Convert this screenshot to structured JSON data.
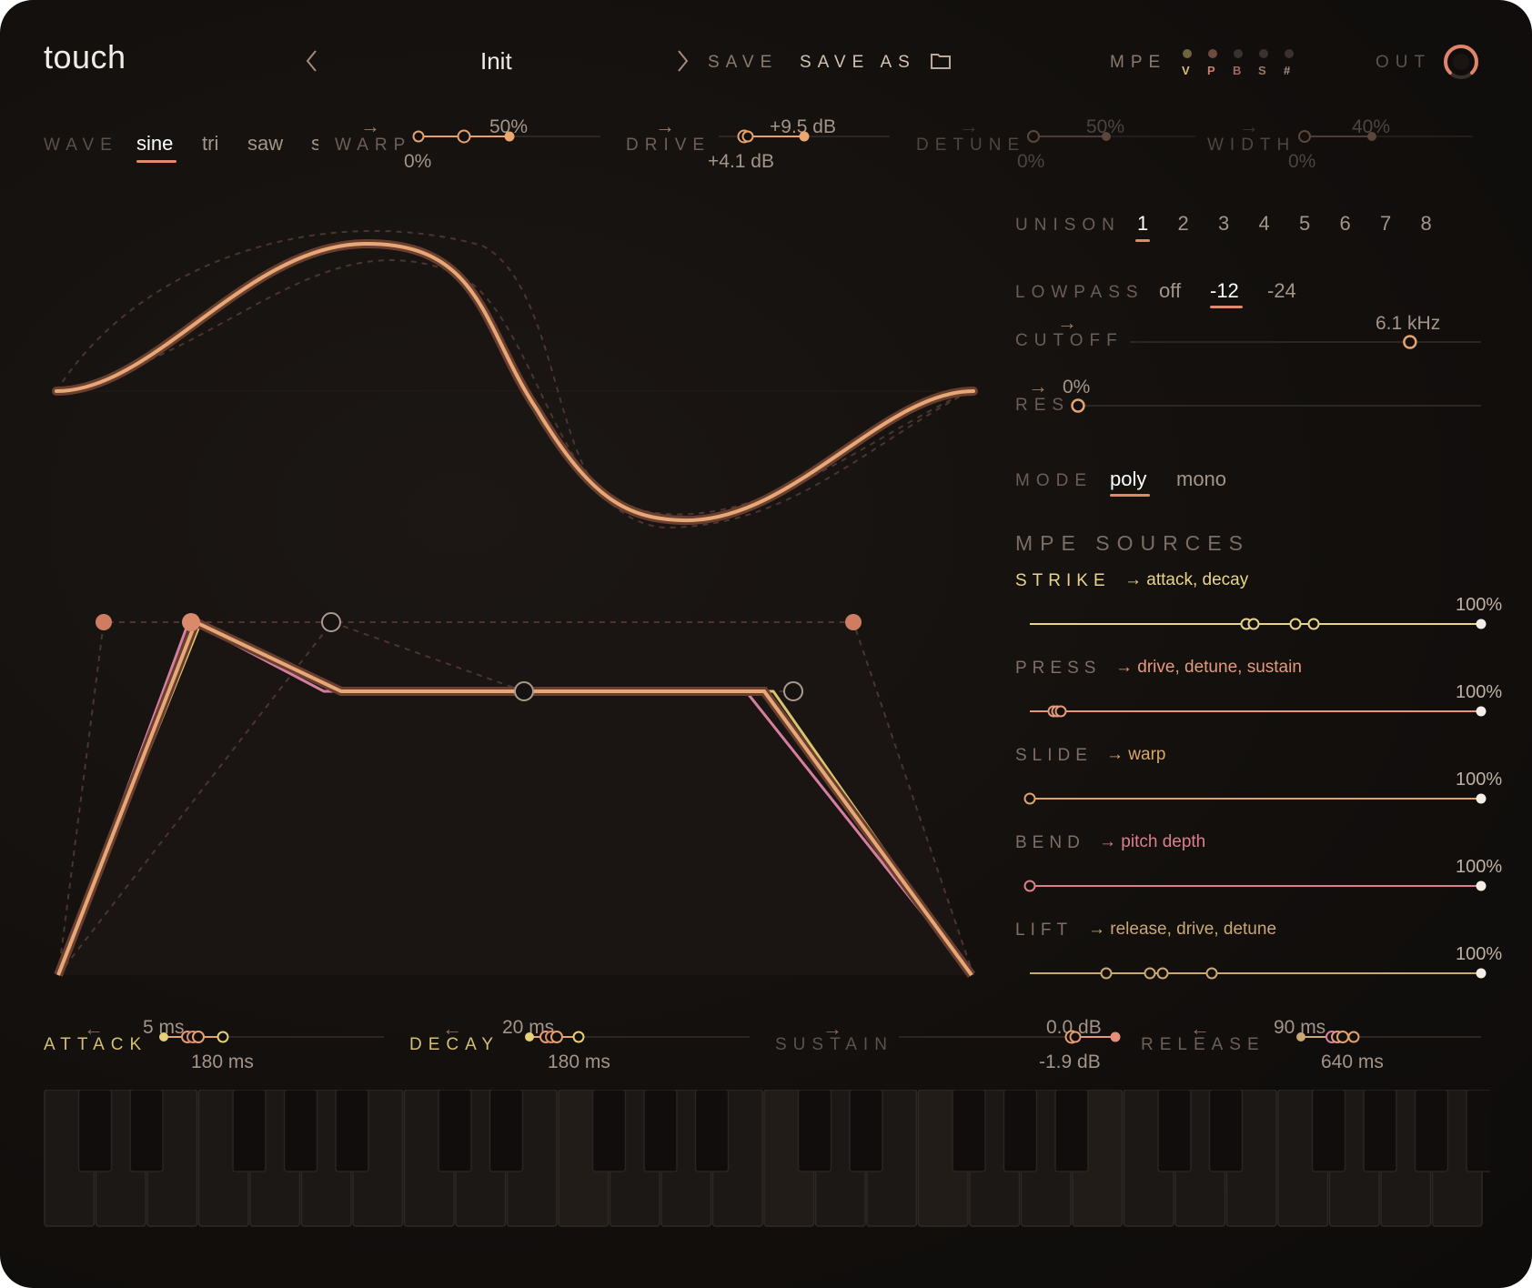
{
  "header": {
    "app_name": "touch",
    "preset_name": "Init",
    "save_label": "SAVE",
    "save_as_label": "SAVE AS",
    "mpe_label": "MPE",
    "mpe_indicators": [
      "V",
      "P",
      "B",
      "S",
      "#"
    ],
    "out_label": "OUT",
    "out_level": 0.85
  },
  "wave": {
    "label": "WAVE",
    "options": [
      "sine",
      "tri",
      "saw",
      "s"
    ],
    "selected": "sine"
  },
  "oscillator_params": [
    {
      "label": "WARP",
      "value": "50%",
      "mod_value": "0%"
    },
    {
      "label": "DRIVE",
      "value": "+9.5 dB",
      "mod_value": "+4.1 dB"
    },
    {
      "label": "DETUNE",
      "value": "50%",
      "mod_value": "0%"
    },
    {
      "label": "WIDTH",
      "value": "40%",
      "mod_value": "0%"
    }
  ],
  "unison": {
    "label": "UNISON",
    "options": [
      "1",
      "2",
      "3",
      "4",
      "5",
      "6",
      "7",
      "8"
    ],
    "selected": "1"
  },
  "lowpass": {
    "label": "LOWPASS",
    "options": [
      "off",
      "-12",
      "-24"
    ],
    "selected": "-12"
  },
  "cutoff": {
    "label": "CUTOFF",
    "value": "6.1 kHz",
    "level": 0.77
  },
  "res": {
    "label": "RES",
    "value": "0%",
    "level": 0.0
  },
  "mode": {
    "label": "MODE",
    "options": [
      "poly",
      "mono"
    ],
    "selected": "poly"
  },
  "mpe_sources": {
    "title": "MPE SOURCES",
    "items": [
      {
        "label": "STRIKE",
        "target": "→ attack, decay",
        "amount": "100%",
        "color": "#e8d58a"
      },
      {
        "label": "PRESS",
        "target": "→ drive, detune, sustain",
        "amount": "100%",
        "color": "#e39a7c"
      },
      {
        "label": "SLIDE",
        "target": "→ warp",
        "amount": "100%",
        "color": "#d9a56a"
      },
      {
        "label": "BEND",
        "target": "→ pitch depth",
        "amount": "100%",
        "color": "#dc7f8c"
      },
      {
        "label": "LIFT",
        "target": "→ release, drive, detune",
        "amount": "100%",
        "color": "#c9a874"
      }
    ]
  },
  "envelope": [
    {
      "label": "ATTACK",
      "value": "5 ms",
      "mod_value": "180 ms"
    },
    {
      "label": "DECAY",
      "value": "20 ms",
      "mod_value": "180 ms"
    },
    {
      "label": "SUSTAIN",
      "value": "0.0 dB",
      "mod_value": "-1.9 dB"
    },
    {
      "label": "RELEASE",
      "value": "90 ms",
      "mod_value": "640 ms"
    }
  ],
  "colors": {
    "accent": "#e08a6a",
    "wave_line": "#e7a877",
    "background": "#120f0d",
    "strike": "#e8d58a",
    "press": "#e39a7c",
    "bend": "#dc7f8c"
  }
}
